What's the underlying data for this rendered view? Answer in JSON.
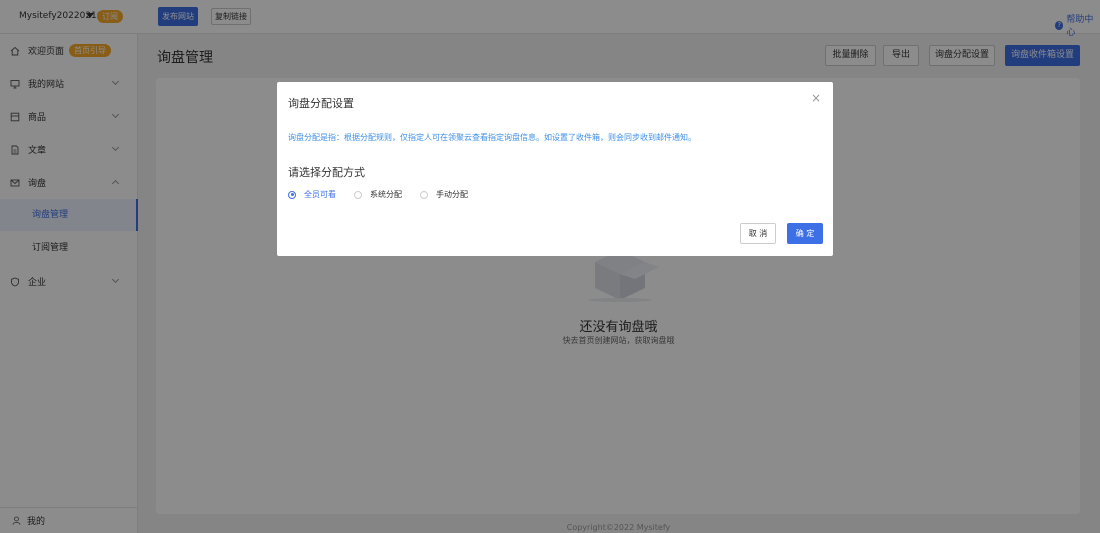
{
  "topbar": {
    "site_name": "Mysitefy20220216",
    "site_badge": "订阅",
    "publish_label": "发布网站",
    "copy_label": "复制链接",
    "help_label": "帮助中心"
  },
  "sidebar": {
    "items": [
      {
        "label": "欢迎页面",
        "icon": "home-icon",
        "badge": "首页引导"
      },
      {
        "label": "我的网站",
        "icon": "monitor-icon"
      },
      {
        "label": "商品",
        "icon": "product-icon"
      },
      {
        "label": "文章",
        "icon": "document-icon"
      },
      {
        "label": "询盘",
        "icon": "mail-icon"
      },
      {
        "label": "企业",
        "icon": "shield-icon"
      }
    ],
    "sub_items": [
      {
        "label": "询盘管理",
        "active": true
      },
      {
        "label": "订阅管理",
        "active": false
      }
    ],
    "footer_label": "我的"
  },
  "main": {
    "title": "询盘管理",
    "actions": {
      "batch_delete": "批量删除",
      "export": "导出",
      "assign_settings": "询盘分配设置",
      "inbox_settings": "询盘收件箱设置"
    },
    "empty_title": "还没有询盘哦",
    "empty_sub": "快去首页创建网站，获取询盘哦",
    "copyright": "Copyright©2022 Mysitefy"
  },
  "modal": {
    "title": "询盘分配设置",
    "close": "×",
    "description": "询盘分配是指：根据分配规则，仅指定人可在领聚云查看指定询盘信息。如设置了收件箱，则会同步收到邮件通知。",
    "section_title": "请选择分配方式",
    "options": [
      {
        "label": "全员可看",
        "checked": true
      },
      {
        "label": "系统分配",
        "checked": false
      },
      {
        "label": "手动分配",
        "checked": false
      }
    ],
    "cancel_label": "取 消",
    "ok_label": "确 定"
  },
  "colors": {
    "accent": "#3d6fe6",
    "badge": "#f7a928",
    "desc_text": "#3d8fe6"
  }
}
